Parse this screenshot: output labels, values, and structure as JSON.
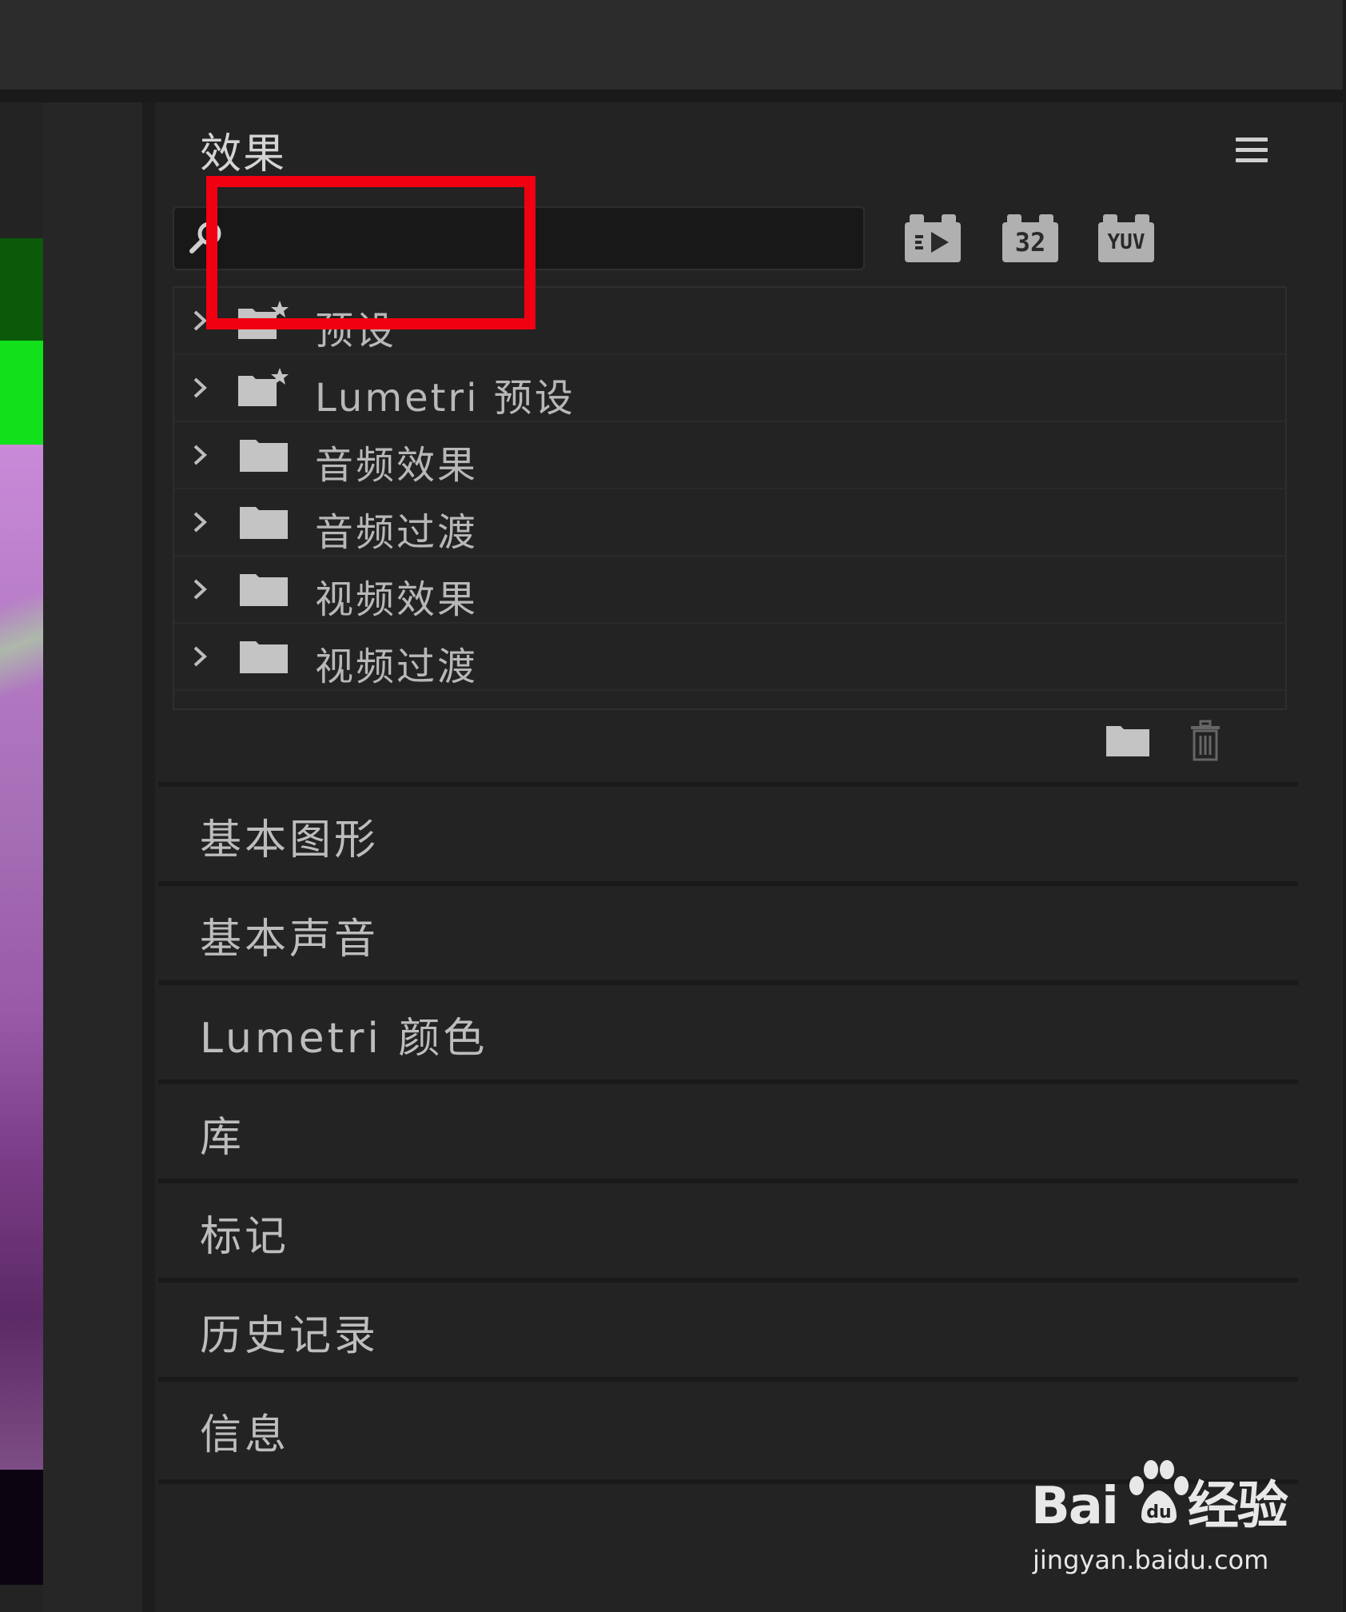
{
  "panel": {
    "title": "效果",
    "menu_icon": "hamburger-menu-icon",
    "search": {
      "value": "",
      "placeholder": ""
    }
  },
  "filters": [
    {
      "icon": "accelerated-effects-icon",
      "label": ""
    },
    {
      "icon": "32bit-color-icon",
      "label": "32"
    },
    {
      "icon": "yuv-effects-icon",
      "label": "YUV"
    }
  ],
  "tree": [
    {
      "label": "预设",
      "icon": "preset-folder-star-icon"
    },
    {
      "label": "Lumetri 预设",
      "icon": "preset-folder-star-icon"
    },
    {
      "label": "音频效果",
      "icon": "folder-icon"
    },
    {
      "label": "音频过渡",
      "icon": "folder-icon"
    },
    {
      "label": "视频效果",
      "icon": "folder-icon"
    },
    {
      "label": "视频过渡",
      "icon": "folder-icon"
    }
  ],
  "sections": [
    {
      "label": "基本图形"
    },
    {
      "label": "基本声音"
    },
    {
      "label": "Lumetri 颜色"
    },
    {
      "label": "库"
    },
    {
      "label": "标记"
    },
    {
      "label": "历史记录"
    },
    {
      "label": "信息"
    }
  ],
  "watermark": {
    "brand_left": "Bai",
    "brand_right": "经验",
    "url": "jingyan.baidu.com"
  },
  "colors": {
    "panel_bg": "#232323",
    "highlight": "#f00010",
    "text": "#bdbdbd"
  }
}
